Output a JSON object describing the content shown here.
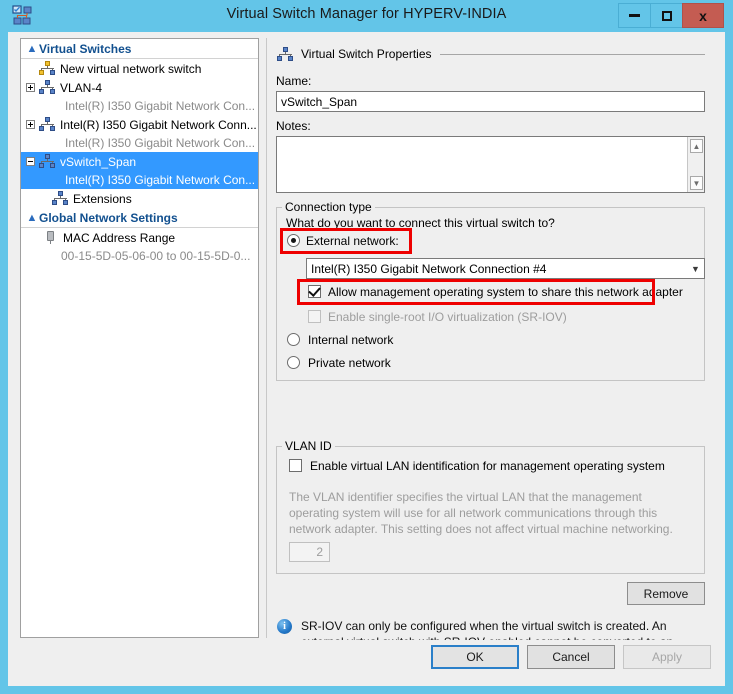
{
  "window": {
    "title": "Virtual Switch Manager for HYPERV-INDIA",
    "app_icon": "virtual-switch-icon",
    "controls": {
      "minimize": "minimize-icon",
      "maximize": "maximize-icon",
      "close": "x"
    },
    "colors": {
      "titlebar": "#63c5e8",
      "close_button": "#c45c52",
      "selection": "#3399ff",
      "highlight_box": "#ee0000",
      "dialog_background": "#efefef",
      "group_header_text": "#12508f"
    }
  },
  "tree": {
    "groups": [
      {
        "label": "Virtual Switches",
        "chevron": "collapse-chevron",
        "items": [
          {
            "label": "New virtual network switch",
            "icon": "new-virtual-switch-icon",
            "expander": "none",
            "selected": false,
            "sub": null
          },
          {
            "label": "VLAN-4",
            "icon": "virtual-switch-icon",
            "expander": "plus",
            "selected": false,
            "sub": "Intel(R) I350 Gigabit Network Con..."
          },
          {
            "label": "Intel(R) I350 Gigabit Network Conn...",
            "icon": "virtual-switch-icon",
            "expander": "plus",
            "selected": false,
            "sub": "Intel(R) I350 Gigabit Network Con..."
          },
          {
            "label": "vSwitch_Span",
            "icon": "virtual-switch-icon",
            "expander": "minus",
            "selected": true,
            "sub": "Intel(R) I350 Gigabit Network Con..."
          },
          {
            "label": "Extensions",
            "icon": "extensions-icon",
            "expander": "none",
            "selected": false,
            "sub": null
          }
        ]
      },
      {
        "label": "Global Network Settings",
        "chevron": "collapse-chevron",
        "items": [
          {
            "label": "MAC Address Range",
            "icon": "mac-address-icon",
            "expander": "none",
            "selected": false,
            "sub": "00-15-5D-05-06-00 to 00-15-5D-0..."
          }
        ]
      }
    ]
  },
  "properties": {
    "header": "Virtual Switch Properties",
    "header_icon": "virtual-switch-icon",
    "name_label": "Name:",
    "name_value": "vSwitch_Span",
    "notes_label": "Notes:",
    "notes_value": "",
    "notes_scroll_up": "scroll-up-arrow",
    "notes_scroll_down": "scroll-down-arrow"
  },
  "connection_type": {
    "caption": "Connection type",
    "question": "What do you want to connect this virtual switch to?",
    "external": {
      "label": "External network:",
      "selected": true,
      "highlighted": true
    },
    "adapter_combo": {
      "value": "Intel(R) I350 Gigabit Network Connection #4",
      "arrow": "chevron-down-icon"
    },
    "allow_management": {
      "label": "Allow management operating system to share this network adapter",
      "checked": true,
      "highlighted": true
    },
    "sriov": {
      "label": "Enable single-root I/O virtualization (SR-IOV)",
      "checked": false,
      "disabled": true
    },
    "internal": {
      "label": "Internal network",
      "selected": false
    },
    "private": {
      "label": "Private network",
      "selected": false
    }
  },
  "vlan": {
    "caption": "VLAN ID",
    "enable_label": "Enable virtual LAN identification for management operating system",
    "enable_checked": false,
    "description": "The VLAN identifier specifies the virtual LAN that the management operating system will use for all network communications through this network adapter. This setting does not affect virtual machine networking.",
    "id_value": "2"
  },
  "actions": {
    "remove_label": "Remove"
  },
  "info": {
    "icon": "info-icon",
    "text": "SR-IOV can only be configured when the virtual switch is created. An external virtual switch with SR-IOV enabled cannot be converted to an internal or private switch."
  },
  "footer": {
    "ok_label": "OK",
    "cancel_label": "Cancel",
    "apply_label": "Apply",
    "apply_disabled": true
  }
}
